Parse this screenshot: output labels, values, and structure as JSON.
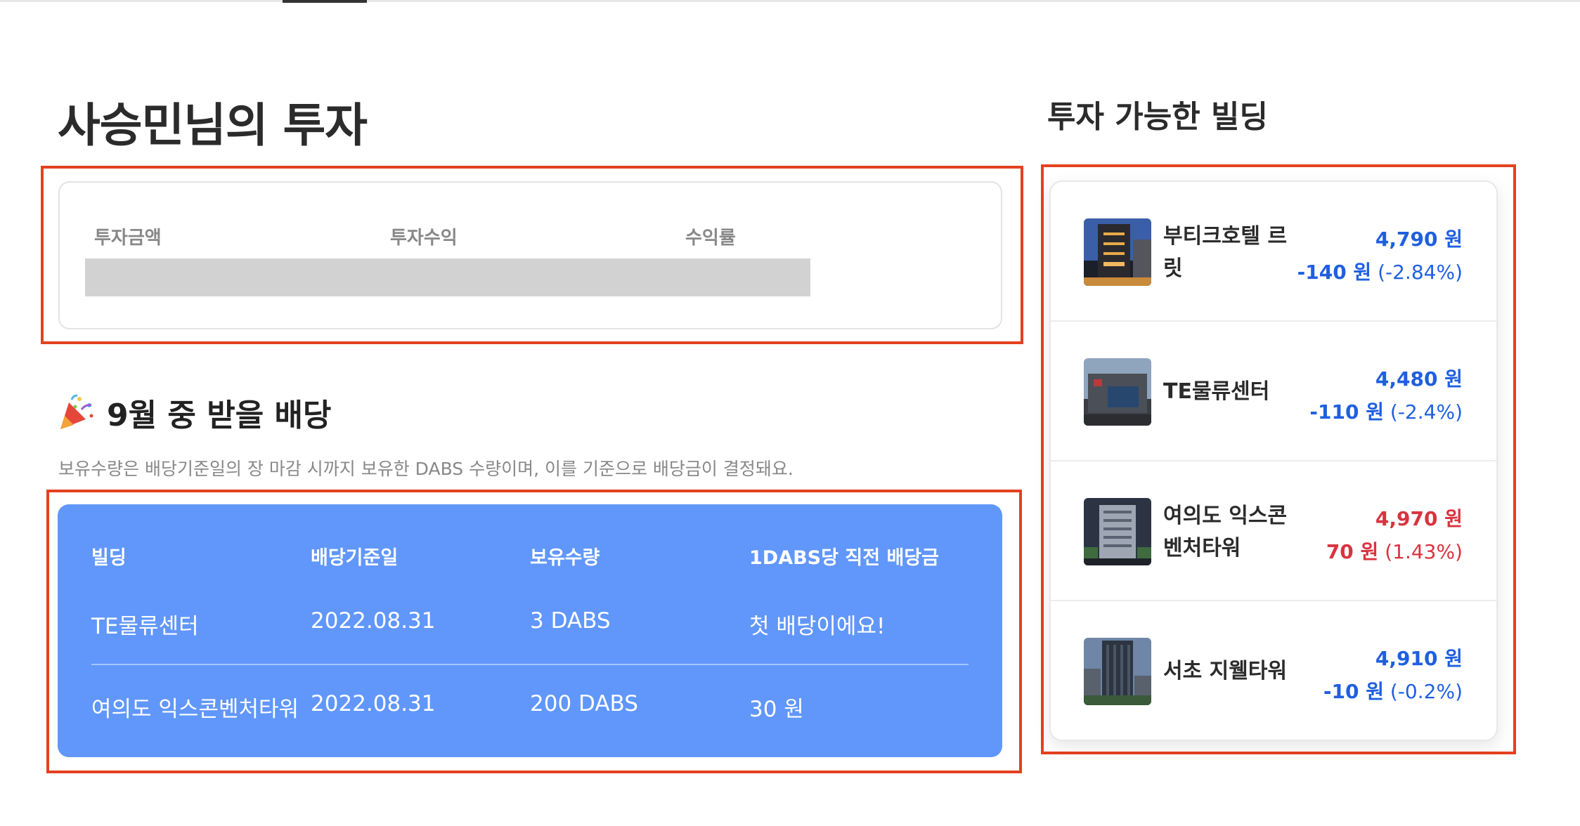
{
  "header": {
    "title": "사승민님의 투자"
  },
  "summary": {
    "labels": [
      "투자금액",
      "투자수익",
      "수익률"
    ]
  },
  "dividends": {
    "title": "9월 중 받을 배당",
    "description": "보유수량은 배당기준일의 장 마감 시까지 보유한 DABS 수량이며, 이를 기준으로 배당금이 결정돼요.",
    "columns": [
      "빌딩",
      "배당기준일",
      "보유수량",
      "1DABS당 직전 배당금"
    ],
    "rows": [
      [
        "TE물류센터",
        "2022.08.31",
        "3 DABS",
        "첫 배당이에요!"
      ],
      [
        "여의도 익스콘벤처타워",
        "2022.08.31",
        "200 DABS",
        "30 원"
      ]
    ]
  },
  "buildings": {
    "title": "투자 가능한 빌딩",
    "items": [
      {
        "name": "부티크호텔 르릿",
        "price": "4,790 원",
        "change": "-140 원",
        "pct": "(-2.84%)",
        "trend": "down"
      },
      {
        "name": "TE물류센터",
        "price": "4,480 원",
        "change": "-110 원",
        "pct": "(-2.4%)",
        "trend": "down"
      },
      {
        "name": "여의도 익스콘벤처타워",
        "price": "4,970 원",
        "change": "70 원",
        "pct": "(1.43%)",
        "trend": "up"
      },
      {
        "name": "서초 지웰타워",
        "price": "4,910 원",
        "change": "-10 원",
        "pct": "(-0.2%)",
        "trend": "down"
      }
    ]
  },
  "colors": {
    "accent": "#6197fb",
    "down": "#1f5fe0",
    "up": "#d9333f",
    "highlight": "#e4411f"
  }
}
